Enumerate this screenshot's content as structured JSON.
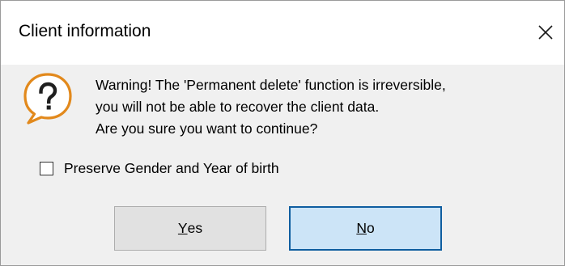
{
  "window": {
    "title": "Client information",
    "close_icon": "close-icon"
  },
  "message": {
    "icon": "question-icon",
    "icon_color": "#e2891c",
    "lines": [
      "Warning! The 'Permanent delete' function is irreversible,",
      "you will not be able to recover the client data.",
      "Are you sure you want to continue?"
    ]
  },
  "options": {
    "preserve_label": "Preserve Gender and Year of birth",
    "preserve_checked": false
  },
  "buttons": {
    "yes": {
      "mnemonic": "Y",
      "rest": "es"
    },
    "no": {
      "mnemonic": "N",
      "rest": "o"
    },
    "default_button_border_color": "#0f5ea0",
    "default_button_background": "#cce4f7"
  }
}
